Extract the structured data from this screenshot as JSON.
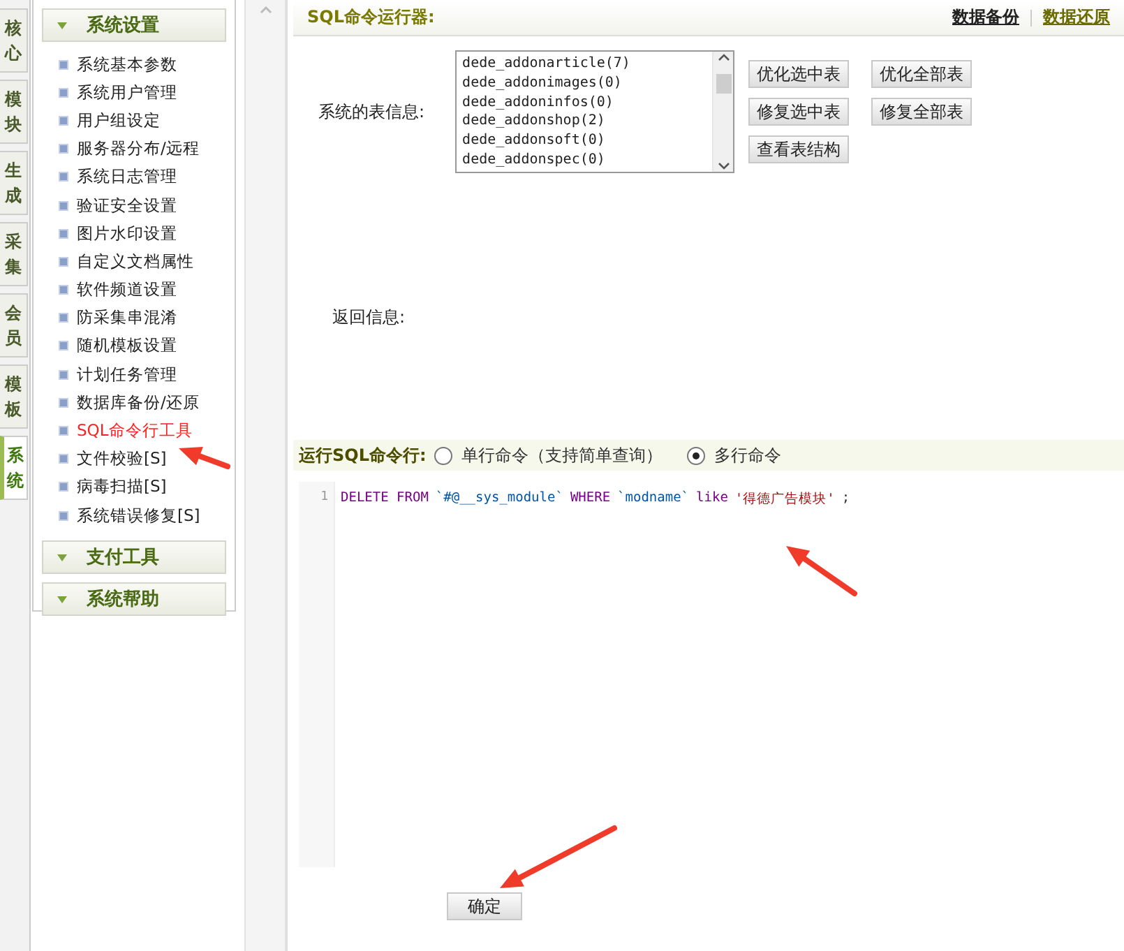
{
  "side_tabs": [
    {
      "label": "核心",
      "selected": false
    },
    {
      "label": "模块",
      "selected": false
    },
    {
      "label": "生成",
      "selected": false
    },
    {
      "label": "采集",
      "selected": false
    },
    {
      "label": "会员",
      "selected": false
    },
    {
      "label": "模板",
      "selected": false
    },
    {
      "label": "系统",
      "selected": true
    }
  ],
  "sidebar": {
    "sections": [
      {
        "title": "系统设置",
        "items": [
          {
            "label": "系统基本参数",
            "selected": false
          },
          {
            "label": "系统用户管理",
            "selected": false
          },
          {
            "label": "用户组设定",
            "selected": false
          },
          {
            "label": "服务器分布/远程",
            "selected": false
          },
          {
            "label": "系统日志管理",
            "selected": false
          },
          {
            "label": "验证安全设置",
            "selected": false
          },
          {
            "label": "图片水印设置",
            "selected": false
          },
          {
            "label": "自定义文档属性",
            "selected": false
          },
          {
            "label": "软件频道设置",
            "selected": false
          },
          {
            "label": "防采集串混淆",
            "selected": false
          },
          {
            "label": "随机模板设置",
            "selected": false
          },
          {
            "label": "计划任务管理",
            "selected": false
          },
          {
            "label": "数据库备份/还原",
            "selected": false
          },
          {
            "label": "SQL命令行工具",
            "selected": true
          },
          {
            "label": "文件校验[S]",
            "selected": false
          },
          {
            "label": "病毒扫描[S]",
            "selected": false
          },
          {
            "label": "系统错误修复[S]",
            "selected": false
          }
        ]
      },
      {
        "title": "支付工具"
      },
      {
        "title": "系统帮助"
      }
    ]
  },
  "header": {
    "title": "SQL命令运行器:",
    "links": [
      "数据备份",
      "数据还原"
    ]
  },
  "tables": {
    "label": "系统的表信息:",
    "items": [
      "dede_addonarticle(7)",
      "dede_addonimages(0)",
      "dede_addoninfos(0)",
      "dede_addonshop(2)",
      "dede_addonsoft(0)",
      "dede_addonspec(0)"
    ],
    "buttons": [
      "优化选中表",
      "优化全部表",
      "修复选中表",
      "修复全部表",
      "查看表结构"
    ]
  },
  "return_info": {
    "label": "返回信息:"
  },
  "run": {
    "label": "运行SQL命令行:",
    "options": [
      {
        "label": "单行命令（支持简单查询）",
        "selected": false
      },
      {
        "label": "多行命令",
        "selected": true
      }
    ]
  },
  "editor": {
    "lines": [
      {
        "number": "1",
        "tokens": [
          {
            "kind": "keyword",
            "text": "DELETE FROM"
          },
          {
            "kind": "identifier",
            "text": "`#@__sys_module`"
          },
          {
            "kind": "keyword",
            "text": "WHERE"
          },
          {
            "kind": "identifier",
            "text": "`modname`"
          },
          {
            "kind": "keyword",
            "text": "like"
          },
          {
            "kind": "string",
            "text": "'得德广告模块'"
          },
          {
            "kind": "punct",
            "text": ";"
          }
        ]
      }
    ]
  },
  "submit": "确定"
}
